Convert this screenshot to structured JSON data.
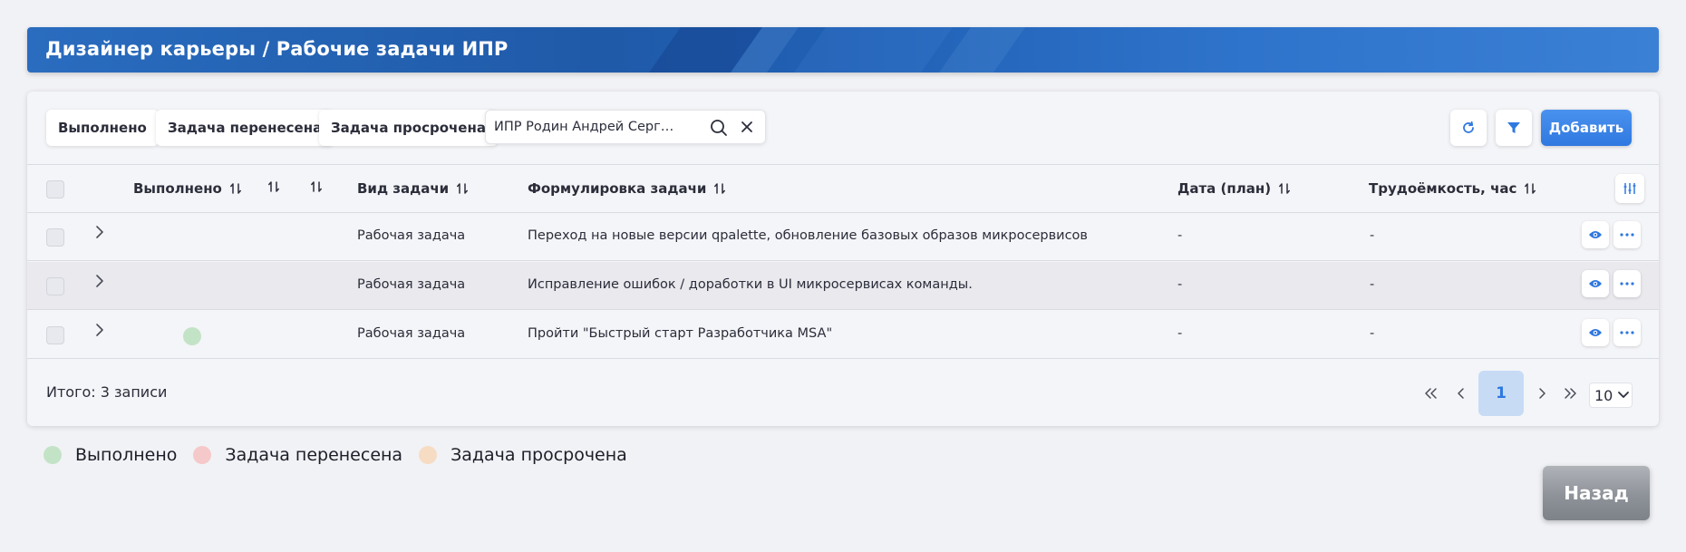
{
  "header": {
    "title": "Дизайнер карьеры / Рабочие задачи ИПР"
  },
  "filters": {
    "chips": [
      "Выполнено",
      "Задача перенесена",
      "Задача просрочена"
    ],
    "search_value": "ИПР Родин Андрей Сергеевич"
  },
  "toolbar": {
    "add_label": "Добавить",
    "refresh_icon": "refresh-icon",
    "filter_icon": "filter-icon"
  },
  "table": {
    "columns": [
      "Выполнено",
      "",
      "",
      "Вид задачи",
      "Формулировка задачи",
      "Дата (план)",
      "Трудоёмкость, час"
    ],
    "rows": [
      {
        "status": "",
        "type": "Рабочая задача",
        "text": "Переход на новые версии qpalette, обновление базовых образов микросервисов",
        "date": "-",
        "effort": "-"
      },
      {
        "status": "",
        "type": "Рабочая задача",
        "text": "Исправление ошибок / доработки в UI микросервисах команды.",
        "date": "-",
        "effort": "-"
      },
      {
        "status": "done",
        "type": "Рабочая задача",
        "text": "Пройти \"Быстрый старт Разработчика MSA\"",
        "date": "-",
        "effort": "-"
      }
    ]
  },
  "footer": {
    "total": "Итого: 3 записи",
    "current_page": "1",
    "page_size": "10"
  },
  "legend": [
    {
      "label": "Выполнено",
      "color": "#c3e3c6"
    },
    {
      "label": "Задача перенесена",
      "color": "#f5c9c9"
    },
    {
      "label": "Задача просрочена",
      "color": "#f7dcc4"
    }
  ],
  "actions": {
    "back_label": "Назад"
  },
  "colors": {
    "accent": "#2f78e0",
    "done": "#c3e3c6",
    "postponed": "#f5c9c9",
    "overdue": "#f7dcc4"
  }
}
